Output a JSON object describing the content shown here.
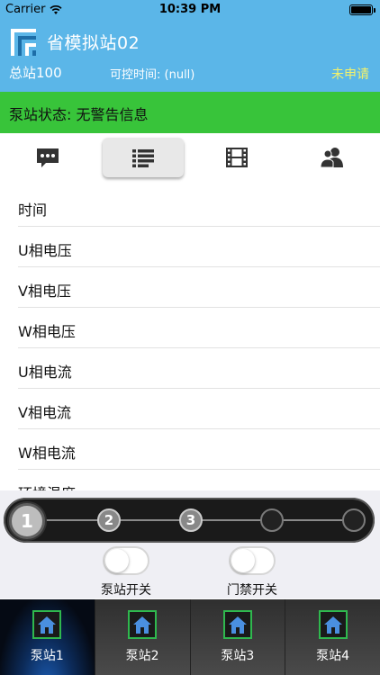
{
  "status_bar": {
    "carrier": "Carrier",
    "time": "10:39 PM"
  },
  "header": {
    "station_name": "省模拟站02",
    "total_station": "总站100",
    "control_time": "可控时间: (null)",
    "apply_status": "未申请"
  },
  "banner": {
    "text": "泵站状态: 无警告信息"
  },
  "tabs": [
    {
      "icon": "chat-icon",
      "active": false
    },
    {
      "icon": "list-icon",
      "active": true
    },
    {
      "icon": "film-icon",
      "active": false
    },
    {
      "icon": "users-icon",
      "active": false
    }
  ],
  "list": {
    "items": [
      "时间",
      "U相电压",
      "V相电压",
      "W相电压",
      "U相电流",
      "V相电流",
      "W相电流",
      "环境温度"
    ]
  },
  "stepper": {
    "steps": [
      "1",
      "2",
      "3",
      "",
      ""
    ],
    "current_step": 1
  },
  "switches": {
    "pump_label": "泵站开关",
    "pump_on": false,
    "door_label": "门禁开关",
    "door_on": false
  },
  "bottom_tabs": [
    {
      "label": "泵站1",
      "active": true
    },
    {
      "label": "泵站2",
      "active": false
    },
    {
      "label": "泵站3",
      "active": false
    },
    {
      "label": "泵站4",
      "active": false
    }
  ],
  "colors": {
    "header": "#5bb6e8",
    "banner": "#38c43a",
    "apply_status": "#f4f26a",
    "home_border": "#2fb84e"
  }
}
